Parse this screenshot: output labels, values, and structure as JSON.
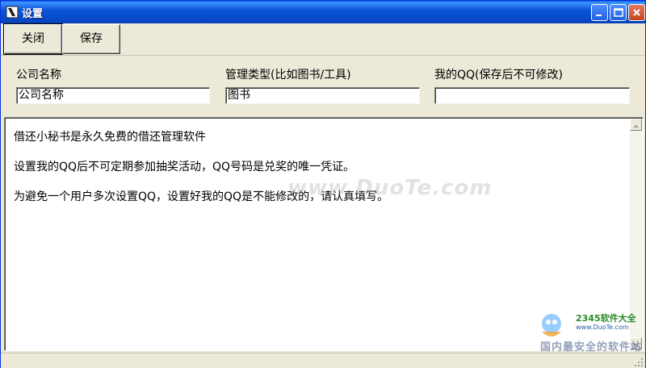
{
  "window": {
    "title": "设置"
  },
  "toolbar": {
    "close_label": "关闭",
    "save_label": "保存"
  },
  "form": {
    "company": {
      "label": "公司名称",
      "value": "公司名称"
    },
    "manage_type": {
      "label": "管理类型(比如图书/工具)",
      "value": "图书"
    },
    "my_qq": {
      "label": "我的QQ(保存后不可修改)",
      "value": ""
    }
  },
  "info": {
    "lines": [
      "借还小秘书是永久免费的借还管理软件",
      "设置我的QQ后不可定期参加抽奖活动，QQ号码是兑奖的唯一凭证。",
      "为避免一个用户多次设置QQ，设置好我的QQ是不能修改的，请认真填写。"
    ]
  },
  "overlay": {
    "watermark": "www.DuoTe.com",
    "logo_name": "2345软件大全",
    "logo_url": "www.DuoTe.com",
    "logo_slogan": "国内最安全的软件站"
  }
}
